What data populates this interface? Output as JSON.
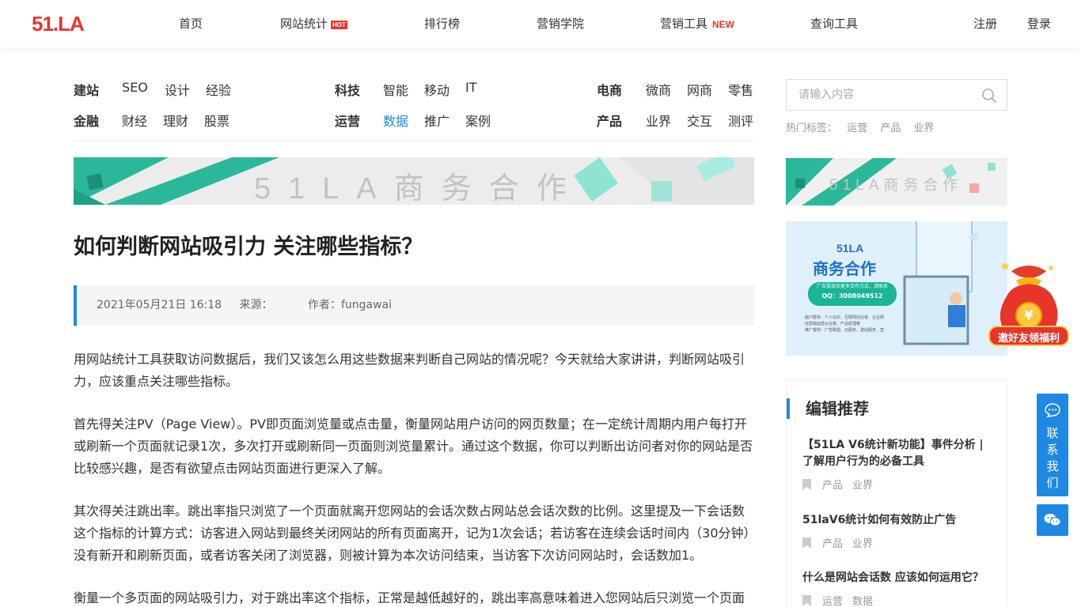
{
  "header": {
    "logo": "51.LA",
    "nav": [
      {
        "label": "首页"
      },
      {
        "label": "网站统计",
        "badge": "HOT"
      },
      {
        "label": "排行榜"
      },
      {
        "label": "营销学院"
      },
      {
        "label": "营销工具",
        "badge": "NEW"
      },
      {
        "label": "查询工具"
      }
    ],
    "register": "注册",
    "login": "登录"
  },
  "categories": {
    "groups": [
      {
        "head": "建站",
        "links": [
          "SEO",
          "设计",
          "经验"
        ]
      },
      {
        "head": "科技",
        "links": [
          "智能",
          "移动",
          "IT"
        ]
      },
      {
        "head": "电商",
        "links": [
          "微商",
          "网商",
          "零售"
        ]
      },
      {
        "head": "金融",
        "links": [
          "财经",
          "理财",
          "股票"
        ]
      },
      {
        "head": "运营",
        "links": [
          "数据",
          "推广",
          "案例"
        ]
      },
      {
        "head": "产品",
        "links": [
          "业界",
          "交互",
          "测评"
        ]
      }
    ]
  },
  "banner": {
    "main_text": "51LA商务合作",
    "side_text": "51LA商务合作"
  },
  "ad": {
    "brand": "51LA",
    "headline": "商务合作",
    "pill_line1": "广告投放及更多合作方式，请联系",
    "pill_line2": "QQ：3008049512",
    "target_line1": "面户群体：个人站长、互联网创业者、企业网",
    "target_line2": "站营销运营从业者、产品经理等",
    "channel_line": "推广载体：广告联盟、云服务、建站服务、营"
  },
  "red_bag": {
    "caption": "邀好友领福利",
    "symbol": "¥"
  },
  "article": {
    "title": "如何判断网站吸引力 关注哪些指标？",
    "date": "2021年05月21日 16:18",
    "source": "来源：",
    "author": "作者：fungawai",
    "paragraphs": [
      "用网站统计工具获取访问数据后，我们又该怎么用这些数据来判断自己网站的情况呢？今天就给大家讲讲，判断网站吸引力，应该重点关注哪些指标。",
      "首先得关注PV（Page View）。PV即页面浏览量或点击量，衡量网站用户访问的网页数量；在一定统计周期内用户每打开或刷新一个页面就记录1次，多次打开或刷新同一页面则浏览量累计。通过这个数据，你可以判断出访问者对你的网站是否比较感兴趣，是否有欲望点击网站页面进行更深入了解。",
      "其次得关注跳出率。跳出率指只浏览了一个页面就离开您网站的会话次数占网站总会话次数的比例。这里提及一下会话数这个指标的计算方式：访客进入网站到最终关闭网站的所有页面离开，记为1次会话；若访客在连续会话时间内（30分钟）没有新开和刷新页面，或者访客关闭了浏览器，则被计算为本次访问结束，当访客下次访问网站时，会话数加1。",
      "衡量一个多页面的网站吸引力，对于跳出率这个指标，正常是越低越好的，跳出率高意味着进入您网站后只浏览一个页面"
    ]
  },
  "sidebar": {
    "search_placeholder": "请输入内容",
    "hot_label": "热门标签：",
    "hot_tags": [
      "运营",
      "产品",
      "业界"
    ],
    "rec_title": "编辑推荐",
    "recs": [
      {
        "title": "【51LA V6统计新功能】事件分析 | 了解用户行为的必备工具",
        "tags": [
          "产品",
          "业界"
        ]
      },
      {
        "title": "51laV6统计如何有效防止广告",
        "tags": [
          "产品",
          "业界"
        ]
      },
      {
        "title": "什么是网站会话数 应该如何运用它？",
        "tags": [
          "运营",
          "数据"
        ]
      }
    ]
  },
  "float": {
    "contact_chars": [
      "联",
      "系",
      "我",
      "们"
    ]
  },
  "colors": {
    "brand_red": "#e8352b",
    "accent_blue": "#1e88e5",
    "banner_green": "#2bb89a"
  }
}
